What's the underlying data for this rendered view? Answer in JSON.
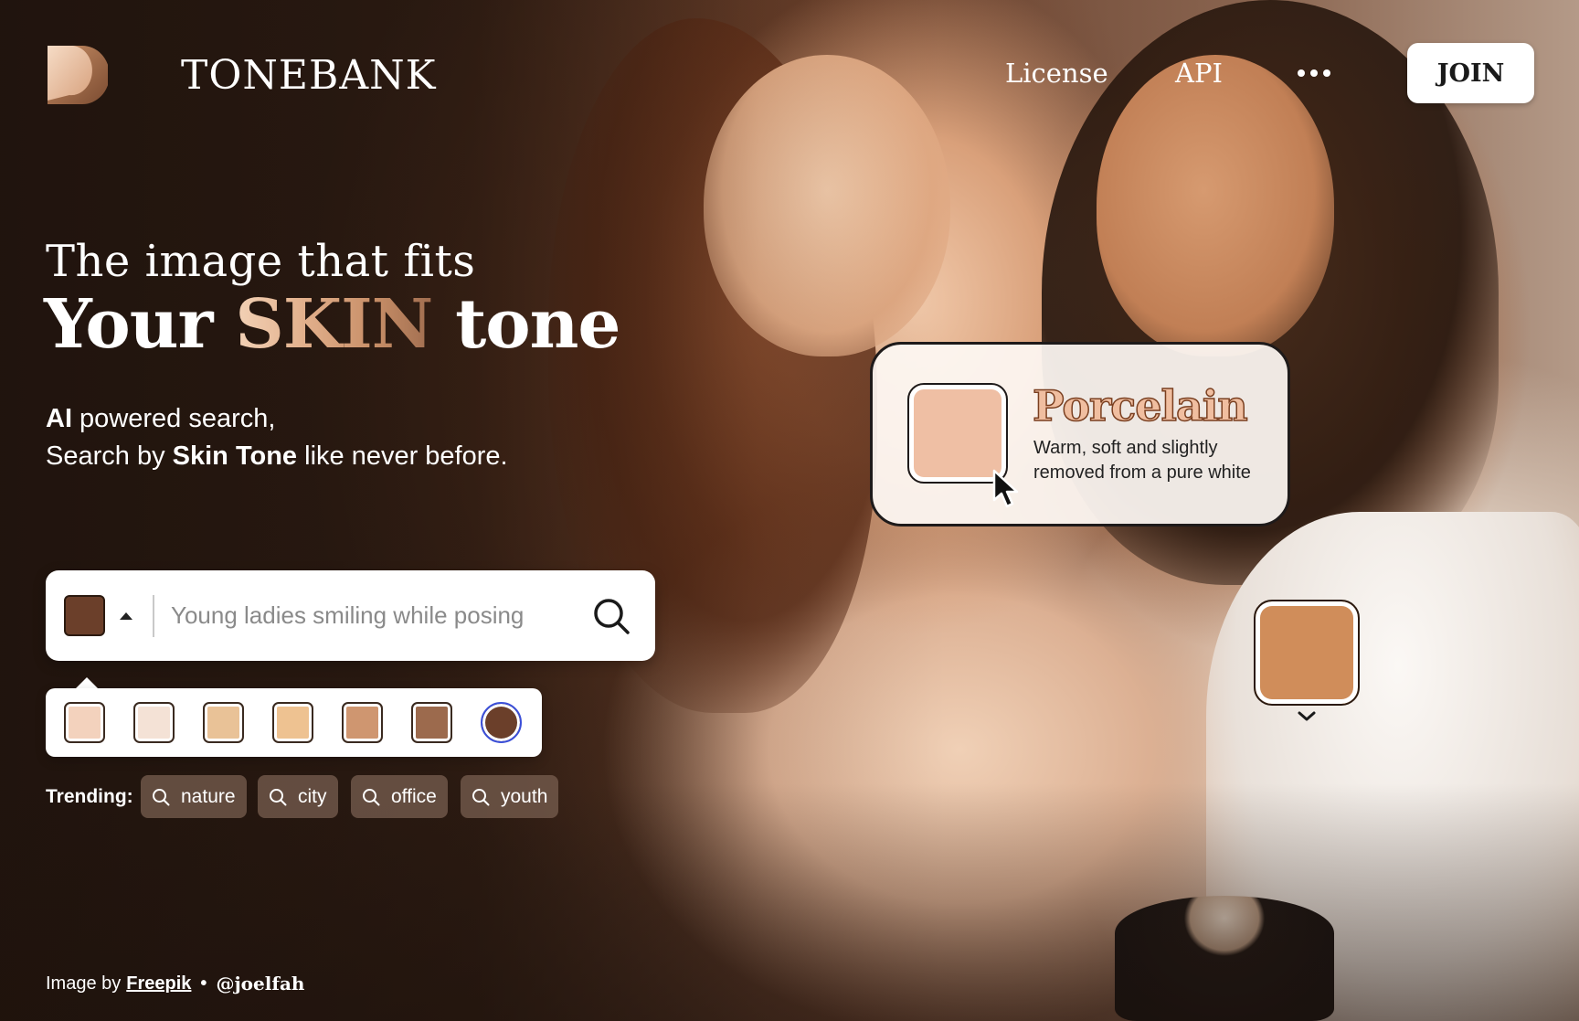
{
  "brand": {
    "name": "TONEBANK"
  },
  "nav": {
    "license": "License",
    "api": "API",
    "join": "JOIN"
  },
  "hero": {
    "line1": "The image that fits",
    "line2_pre": "Your ",
    "line2_skin": "SKIN",
    "line2_post": " tone",
    "sub1_bold": "AI",
    "sub1_rest": " powered search,",
    "sub2_pre": "Search by ",
    "sub2_bold": "Skin Tone",
    "sub2_post": " like never before."
  },
  "search": {
    "placeholder": "Young ladies smiling while posing",
    "current_tone_color": "#6b3f2a"
  },
  "swatches": [
    "#f3d2bd",
    "#f4e2d6",
    "#e9c297",
    "#eec291",
    "#cf9670",
    "#9c6a4d",
    "#6b3f2a"
  ],
  "selected_swatch_index": 6,
  "trending": {
    "label": "Trending:",
    "items": [
      "nature",
      "city",
      "office",
      "youth"
    ]
  },
  "tone_card": {
    "title": "Porcelain",
    "description": "Warm, soft and slightly removed from a pure white",
    "color": "#efbfa4"
  },
  "floating_swatch": {
    "color": "#d08d5a"
  },
  "credit": {
    "prefix": "Image by",
    "source": "Freepik",
    "separator": "•",
    "handle": "@joelfah"
  },
  "icons": {
    "logo": "tonebank-logo-icon",
    "search": "search-icon",
    "more": "more-dots-icon",
    "caret": "caret-up-icon",
    "cursor": "cursor-arrow-icon",
    "chevron": "chevron-down-icon"
  }
}
